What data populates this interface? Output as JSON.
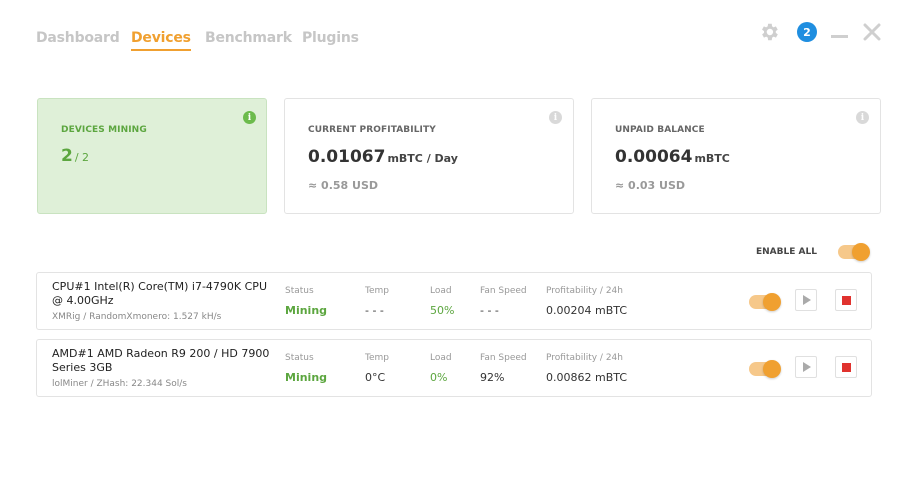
{
  "tabs": [
    {
      "label": "Dashboard",
      "active": false
    },
    {
      "label": "Devices",
      "active": true
    },
    {
      "label": "Benchmark",
      "active": false
    },
    {
      "label": "Plugins",
      "active": false
    }
  ],
  "header": {
    "notification_count": "2"
  },
  "cards": {
    "devices_mining": {
      "label": "DEVICES MINING",
      "value": "2",
      "total": "/ 2"
    },
    "profitability": {
      "label": "CURRENT PROFITABILITY",
      "value": "0.01067",
      "unit": "mBTC / Day",
      "sub": "≈ 0.58 USD"
    },
    "balance": {
      "label": "UNPAID BALANCE",
      "value": "0.00064",
      "unit": "mBTC",
      "sub": "≈ 0.03 USD"
    }
  },
  "enable_all": {
    "label": "ENABLE ALL",
    "on": true
  },
  "columns": {
    "status": "Status",
    "temp": "Temp",
    "load": "Load",
    "fan": "Fan Speed",
    "profit": "Profitability / 24h"
  },
  "devices": [
    {
      "name": "CPU#1 Intel(R) Core(TM) i7-4790K CPU @ 4.00GHz",
      "algo": "XMRig / RandomXmonero: 1.527 kH/s",
      "status": "Mining",
      "temp": "- - -",
      "load": "50%",
      "fan": "- - -",
      "profit": "0.00204 mBTC",
      "enabled": true
    },
    {
      "name": "AMD#1 AMD Radeon R9 200 / HD 7900 Series 3GB",
      "algo": "lolMiner / ZHash: 22.344 Sol/s",
      "status": "Mining",
      "temp": "0°C",
      "load": "0%",
      "fan": "92%",
      "profit": "0.00862 mBTC",
      "enabled": true
    }
  ],
  "colors": {
    "accent": "#f0a030",
    "success": "#5ca63f",
    "badge": "#1f8ee0",
    "stop": "#e0322e"
  }
}
